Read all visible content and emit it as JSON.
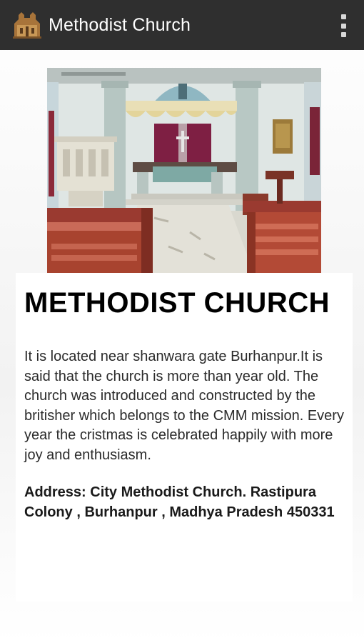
{
  "app_bar": {
    "title": "Methodist Church",
    "app_icon": "church-building-icon",
    "overflow_icon": "overflow-menu-icon",
    "background_color": "#2f2f2f"
  },
  "content": {
    "photo_subject": "church-interior-photo",
    "heading": "METHODIST CHURCH",
    "description": "It is located near shanwara gate Burhanpur.It is said that the church is more than year old. The church was introduced and constructed by the britisher which belongs to the CMM mission. Every year the cristmas is celebrated happily with more joy and enthusiasm.",
    "address": "Address: City Methodist Church. Rastipura Colony , Burhanpur , Madhya Pradesh 450331"
  }
}
